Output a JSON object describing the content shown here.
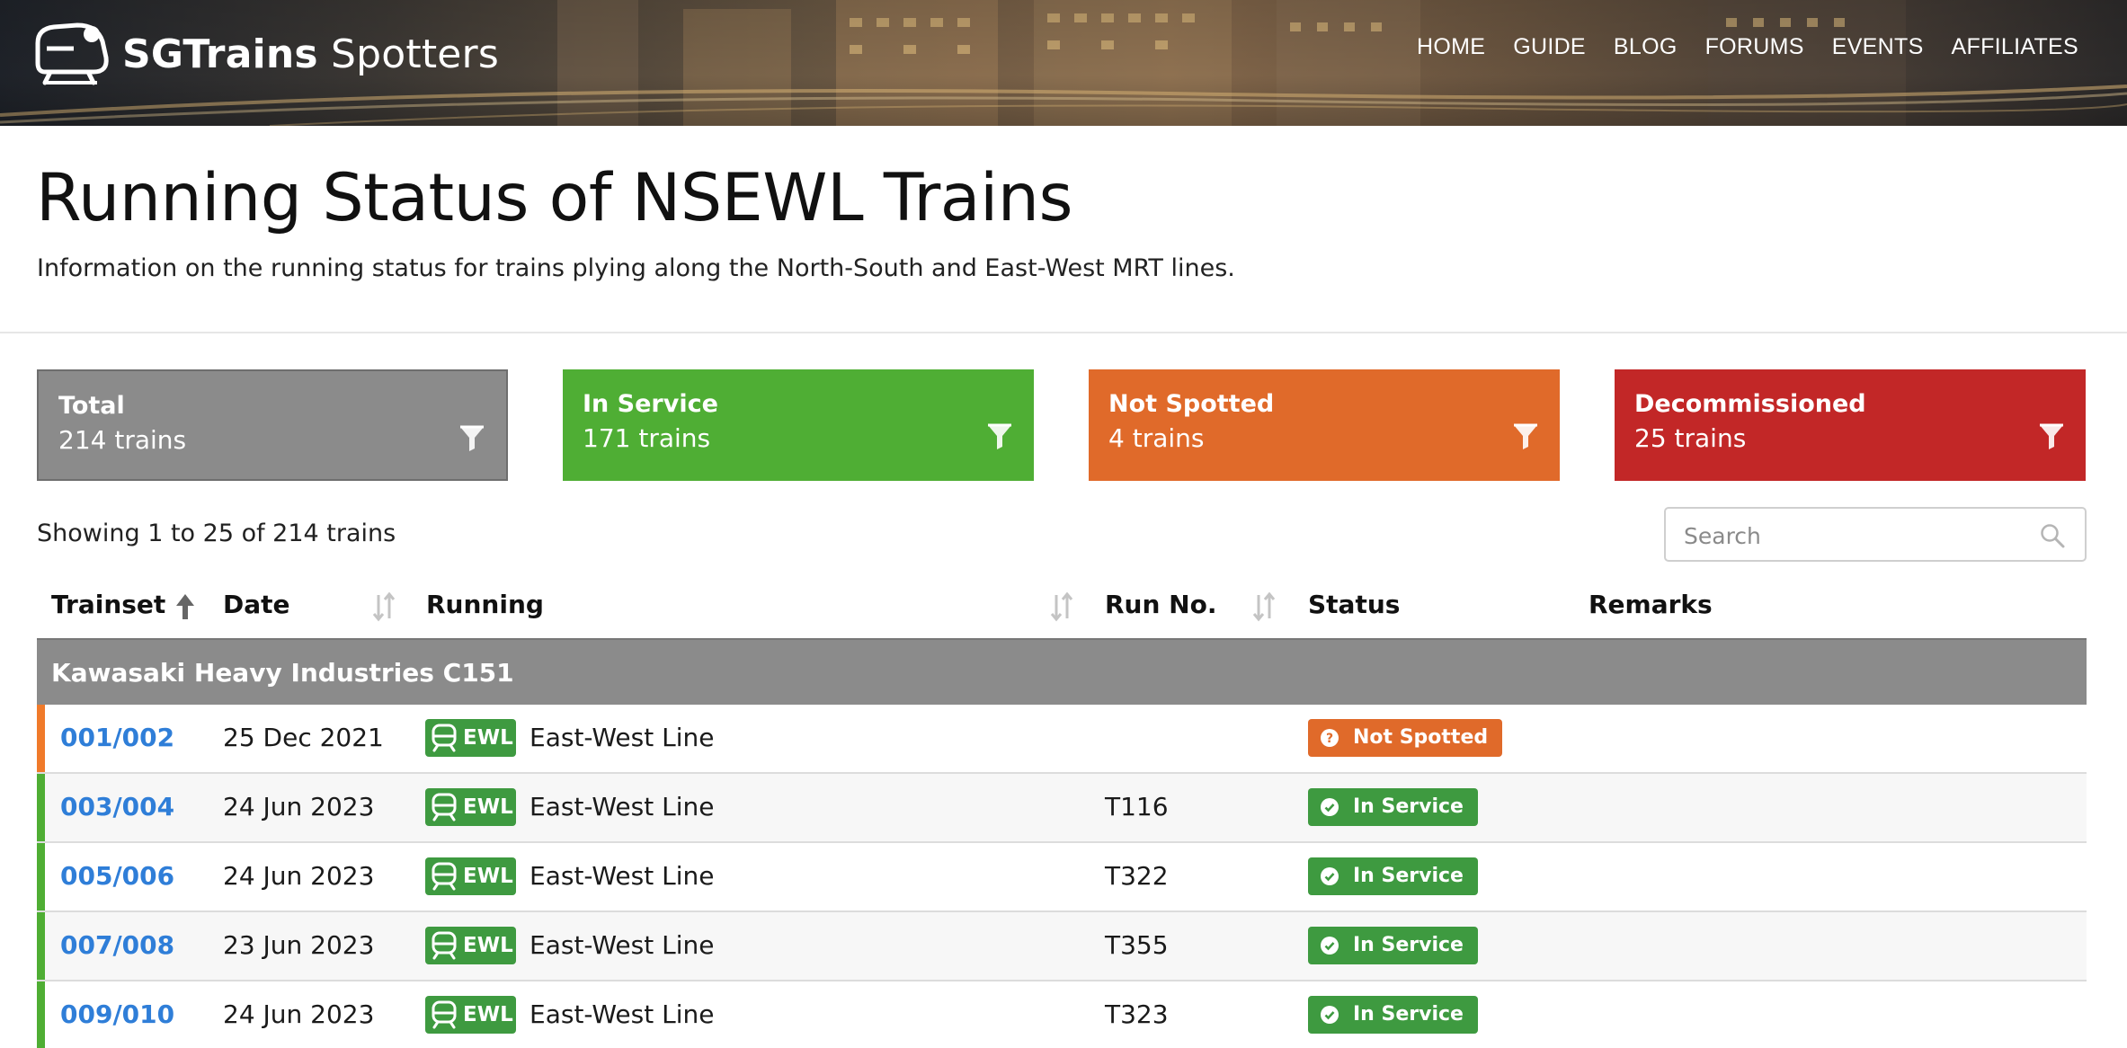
{
  "brand": {
    "name_bold": "SGTrains",
    "name_light": "Spotters"
  },
  "nav": [
    "HOME",
    "GUIDE",
    "BLOG",
    "FORUMS",
    "EVENTS",
    "AFFILIATES"
  ],
  "page": {
    "title": "Running Status of NSEWL Trains",
    "subtitle": "Information on the running status for trains plying along the North-South and East-West MRT lines."
  },
  "cards": [
    {
      "title": "Total",
      "value": "214 trains",
      "color": "#8b8b8b"
    },
    {
      "title": "In Service",
      "value": "171 trains",
      "color": "#4fae34"
    },
    {
      "title": "Not Spotted",
      "value": "4 trains",
      "color": "#e06a2a"
    },
    {
      "title": "Decommissioned",
      "value": "25 trains",
      "color": "#c22727"
    }
  ],
  "table_info": {
    "showing": "Showing 1 to 25 of 214 trains"
  },
  "search": {
    "placeholder": "Search",
    "value": ""
  },
  "table": {
    "headers": [
      "Trainset",
      "Date",
      "Running",
      "Run No.",
      "Status",
      "Remarks"
    ],
    "group": "Kawasaki Heavy Industries C151",
    "rows": [
      {
        "trainset": "001/002",
        "date": "25 Dec 2021",
        "line_badge": "EWL",
        "line": "East-West Line",
        "run_no": "",
        "status": "Not Spotted",
        "remarks": ""
      },
      {
        "trainset": "003/004",
        "date": "24 Jun 2023",
        "line_badge": "EWL",
        "line": "East-West Line",
        "run_no": "T116",
        "status": "In Service",
        "remarks": ""
      },
      {
        "trainset": "005/006",
        "date": "24 Jun 2023",
        "line_badge": "EWL",
        "line": "East-West Line",
        "run_no": "T322",
        "status": "In Service",
        "remarks": ""
      },
      {
        "trainset": "007/008",
        "date": "23 Jun 2023",
        "line_badge": "EWL",
        "line": "East-West Line",
        "run_no": "T355",
        "status": "In Service",
        "remarks": ""
      },
      {
        "trainset": "009/010",
        "date": "24 Jun 2023",
        "line_badge": "EWL",
        "line": "East-West Line",
        "run_no": "T323",
        "status": "In Service",
        "remarks": ""
      }
    ]
  },
  "colors": {
    "link": "#2f7ed8",
    "ewl": "#3e9a40",
    "not_spotted": "#e06a2a",
    "in_service": "#3e9a40",
    "stripe_not_spotted": "#f07a2a",
    "stripe_in_service": "#4fae34"
  }
}
